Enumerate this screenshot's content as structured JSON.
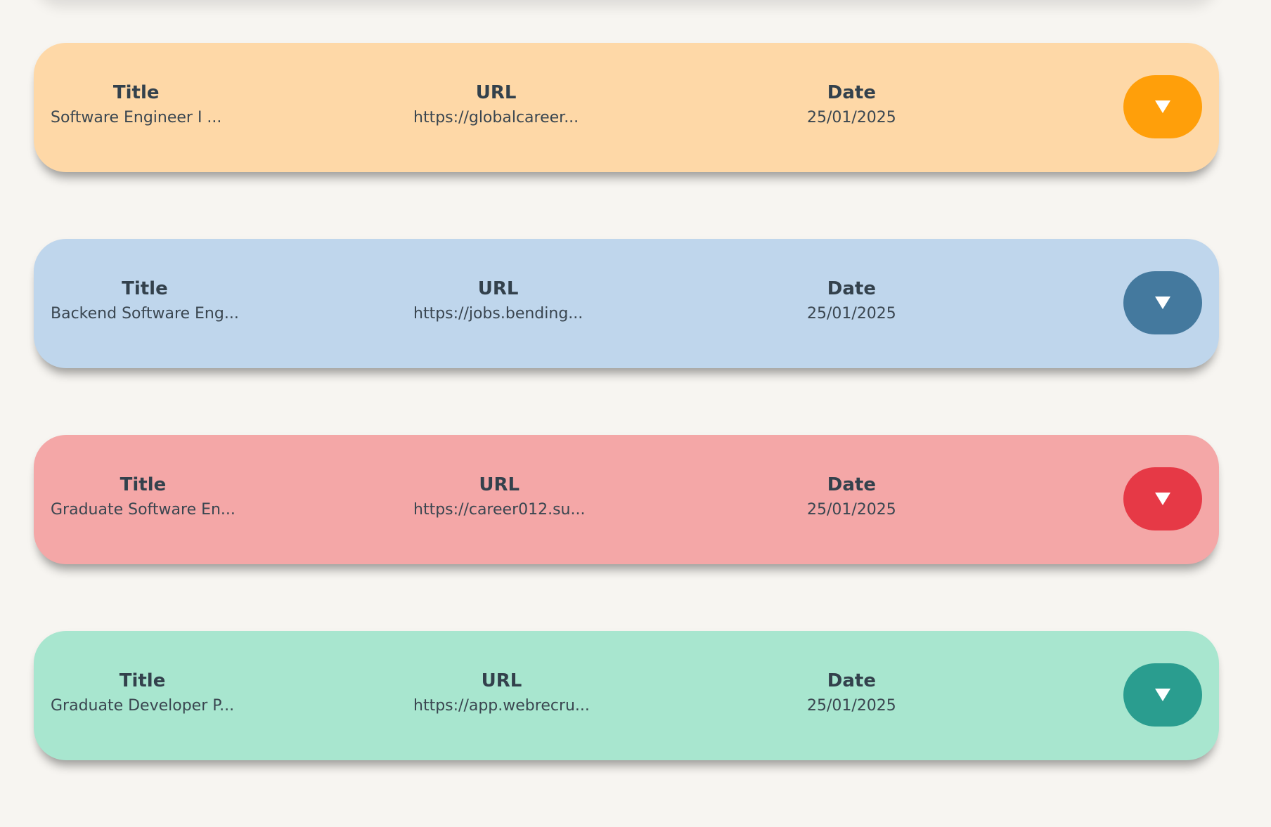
{
  "labels": {
    "title": "Title",
    "url": "URL",
    "date": "Date"
  },
  "cards": [
    {
      "title": "Software Engineer I ...",
      "url": "https://globalcareer...",
      "date": "25/01/2025",
      "bg_color": "#fed8a7",
      "accent_color": "#ff9f0a",
      "icon": "triangle-down-icon"
    },
    {
      "title": "Backend Software Eng...",
      "url": "https://jobs.bending...",
      "date": "25/01/2025",
      "bg_color": "#bfd6ec",
      "accent_color": "#44799e",
      "icon": "triangle-down-icon"
    },
    {
      "title": "Graduate Software En...",
      "url": "https://career012.su...",
      "date": "25/01/2025",
      "bg_color": "#f4a7a7",
      "accent_color": "#e63946",
      "icon": "triangle-down-icon"
    },
    {
      "title": "Graduate Developer P...",
      "url": "https://app.webrecru...",
      "date": "25/01/2025",
      "bg_color": "#a8e6cf",
      "accent_color": "#2a9d8f",
      "icon": "triangle-down-icon"
    }
  ]
}
